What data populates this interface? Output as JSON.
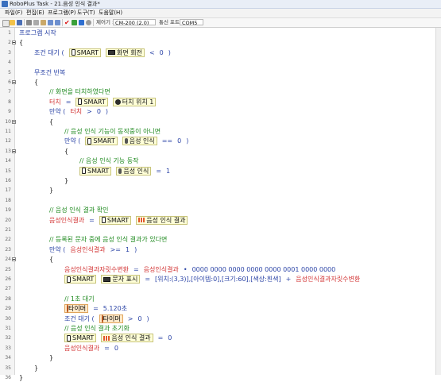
{
  "window": {
    "title": "RoboPlus Task - 21.음성 인식 결과*"
  },
  "menu": [
    "파일(F)",
    "편집(E)",
    "프로그램(P)",
    "도구(T)",
    "도움말(H)"
  ],
  "toolbar": {
    "controller_label": "제어기 :",
    "controller_value": "CM-200 (2.0)",
    "port_label": "통신 포트 :",
    "port_value": "COM5",
    "icons": [
      "new-icon",
      "open-icon",
      "save-icon",
      "cut-icon",
      "copy-icon",
      "paste-icon",
      "undo-icon",
      "redo-icon",
      "check-icon",
      "download-icon",
      "debug-icon",
      "search-icon"
    ]
  },
  "lines": [
    {
      "n": "1",
      "indent": 0,
      "tokens": [
        {
          "t": "kw",
          "v": "프로그램 시작"
        }
      ]
    },
    {
      "n": "2",
      "indent": 0,
      "fold": true,
      "tokens": [
        {
          "t": "plain",
          "v": "{"
        }
      ]
    },
    {
      "n": "3",
      "indent": 1,
      "tokens": [
        {
          "t": "kw",
          "v": "조건 대기 ("
        },
        {
          "t": "block",
          "icon": "phone-ico",
          "label": "SMART"
        },
        {
          "t": "block",
          "icon": "screen-ico",
          "label": "화면 회전"
        },
        {
          "t": "op",
          "v": "<"
        },
        {
          "t": "num",
          "v": "0"
        },
        {
          "t": "kw",
          "v": ")"
        }
      ]
    },
    {
      "n": "4",
      "indent": 0,
      "tokens": []
    },
    {
      "n": "5",
      "indent": 1,
      "tokens": [
        {
          "t": "kw",
          "v": "무조건 반복"
        }
      ]
    },
    {
      "n": "6",
      "indent": 1,
      "fold": true,
      "tokens": [
        {
          "t": "plain",
          "v": "{"
        }
      ]
    },
    {
      "n": "7",
      "indent": 2,
      "tokens": [
        {
          "t": "cm",
          "v": "// 화면을 터치하였다면"
        }
      ]
    },
    {
      "n": "8",
      "indent": 2,
      "tokens": [
        {
          "t": "var",
          "v": "터치"
        },
        {
          "t": "op",
          "v": "="
        },
        {
          "t": "block",
          "icon": "phone-ico",
          "label": "SMART"
        },
        {
          "t": "block",
          "icon": "hand-ico",
          "label": "터치 위치 1"
        }
      ]
    },
    {
      "n": "9",
      "indent": 2,
      "tokens": [
        {
          "t": "kw",
          "v": "만약 ("
        },
        {
          "t": "var",
          "v": "터치"
        },
        {
          "t": "op",
          "v": ">"
        },
        {
          "t": "num",
          "v": "0"
        },
        {
          "t": "kw",
          "v": ")"
        }
      ]
    },
    {
      "n": "10",
      "indent": 2,
      "fold": true,
      "tokens": [
        {
          "t": "plain",
          "v": "{"
        }
      ]
    },
    {
      "n": "11",
      "indent": 3,
      "tokens": [
        {
          "t": "cm",
          "v": "// 음성 인식 기능이 동작중이 아니면"
        }
      ]
    },
    {
      "n": "12",
      "indent": 3,
      "tokens": [
        {
          "t": "kw",
          "v": "만약 ("
        },
        {
          "t": "block",
          "icon": "phone-ico",
          "label": "SMART"
        },
        {
          "t": "block",
          "icon": "mic-ico",
          "label": "음성 인식"
        },
        {
          "t": "op",
          "v": "=="
        },
        {
          "t": "num",
          "v": "0"
        },
        {
          "t": "kw",
          "v": ")"
        }
      ]
    },
    {
      "n": "13",
      "indent": 3,
      "fold": true,
      "tokens": [
        {
          "t": "plain",
          "v": "{"
        }
      ]
    },
    {
      "n": "14",
      "indent": 4,
      "tokens": [
        {
          "t": "cm",
          "v": "// 음성 인식 기능 동작"
        }
      ]
    },
    {
      "n": "15",
      "indent": 4,
      "tokens": [
        {
          "t": "block",
          "icon": "phone-ico",
          "label": "SMART"
        },
        {
          "t": "block",
          "icon": "mic-ico",
          "label": "음성 인식"
        },
        {
          "t": "op",
          "v": "="
        },
        {
          "t": "num",
          "v": "1"
        }
      ]
    },
    {
      "n": "16",
      "indent": 3,
      "tokens": [
        {
          "t": "plain",
          "v": "}"
        }
      ]
    },
    {
      "n": "17",
      "indent": 2,
      "tokens": [
        {
          "t": "plain",
          "v": "}"
        }
      ]
    },
    {
      "n": "18",
      "indent": 0,
      "tokens": []
    },
    {
      "n": "19",
      "indent": 2,
      "tokens": [
        {
          "t": "cm",
          "v": "// 음성 인식 결과 확인"
        }
      ]
    },
    {
      "n": "20",
      "indent": 2,
      "tokens": [
        {
          "t": "var",
          "v": "음성인식결과"
        },
        {
          "t": "op",
          "v": "="
        },
        {
          "t": "block",
          "icon": "phone-ico",
          "label": "SMART"
        },
        {
          "t": "block",
          "icon": "wave-ico",
          "label": "음성 인식 결과"
        }
      ]
    },
    {
      "n": "21",
      "indent": 0,
      "tokens": []
    },
    {
      "n": "22",
      "indent": 2,
      "tokens": [
        {
          "t": "cm",
          "v": "// 등록된 문자 중에 음성 인식 결과가 있다면"
        }
      ]
    },
    {
      "n": "23",
      "indent": 2,
      "tokens": [
        {
          "t": "kw",
          "v": "만약 ("
        },
        {
          "t": "var",
          "v": "음성인식결과"
        },
        {
          "t": "op",
          "v": ">="
        },
        {
          "t": "num",
          "v": "1"
        },
        {
          "t": "kw",
          "v": ")"
        }
      ]
    },
    {
      "n": "24",
      "indent": 2,
      "fold": true,
      "tokens": [
        {
          "t": "plain",
          "v": "{"
        }
      ]
    },
    {
      "n": "25",
      "indent": 3,
      "tokens": [
        {
          "t": "var",
          "v": "음성인식결과자릿수변환"
        },
        {
          "t": "op",
          "v": "="
        },
        {
          "t": "var",
          "v": "음성인식결과"
        },
        {
          "t": "op",
          "v": "•"
        },
        {
          "t": "hex",
          "v": "0000 0000 0000 0000 0000 0001 0000 0000"
        }
      ]
    },
    {
      "n": "26",
      "indent": 3,
      "tokens": [
        {
          "t": "block",
          "icon": "phone-ico",
          "label": "SMART"
        },
        {
          "t": "block",
          "icon": "screen-ico",
          "label": "문자 표시"
        },
        {
          "t": "op",
          "v": "="
        },
        {
          "t": "hex",
          "v": "[위치:(3,3)],[아이템:0],[크기:60],[색상:흰색]"
        },
        {
          "t": "op",
          "v": "+"
        },
        {
          "t": "var",
          "v": "음성인식결과자릿수변환"
        }
      ]
    },
    {
      "n": "27",
      "indent": 0,
      "tokens": []
    },
    {
      "n": "28",
      "indent": 3,
      "tokens": [
        {
          "t": "cm",
          "v": "// 1초 대기"
        }
      ]
    },
    {
      "n": "29",
      "indent": 3,
      "tokens": [
        {
          "t": "timer",
          "label": "타이머"
        },
        {
          "t": "op",
          "v": "="
        },
        {
          "t": "num",
          "v": "5.120초"
        }
      ]
    },
    {
      "n": "30",
      "indent": 3,
      "tokens": [
        {
          "t": "kw",
          "v": "조건 대기 ("
        },
        {
          "t": "timer",
          "label": "타이머"
        },
        {
          "t": "op",
          "v": ">"
        },
        {
          "t": "num",
          "v": "0"
        },
        {
          "t": "kw",
          "v": ")"
        }
      ]
    },
    {
      "n": "31",
      "indent": 3,
      "tokens": [
        {
          "t": "cm",
          "v": "// 음성 인식 결과 초기화"
        }
      ]
    },
    {
      "n": "32",
      "indent": 3,
      "tokens": [
        {
          "t": "block",
          "icon": "phone-ico",
          "label": "SMART"
        },
        {
          "t": "block",
          "icon": "wave-ico",
          "label": "음성 인식 결과"
        },
        {
          "t": "op",
          "v": "="
        },
        {
          "t": "num",
          "v": "0"
        }
      ]
    },
    {
      "n": "33",
      "indent": 3,
      "tokens": [
        {
          "t": "var",
          "v": "음성인식결과"
        },
        {
          "t": "op",
          "v": "="
        },
        {
          "t": "num",
          "v": "0"
        }
      ]
    },
    {
      "n": "34",
      "indent": 2,
      "tokens": [
        {
          "t": "plain",
          "v": "}"
        }
      ]
    },
    {
      "n": "35",
      "indent": 1,
      "tokens": [
        {
          "t": "plain",
          "v": "}"
        }
      ]
    },
    {
      "n": "36",
      "indent": 0,
      "tokens": [
        {
          "t": "plain",
          "v": "}"
        }
      ]
    }
  ]
}
